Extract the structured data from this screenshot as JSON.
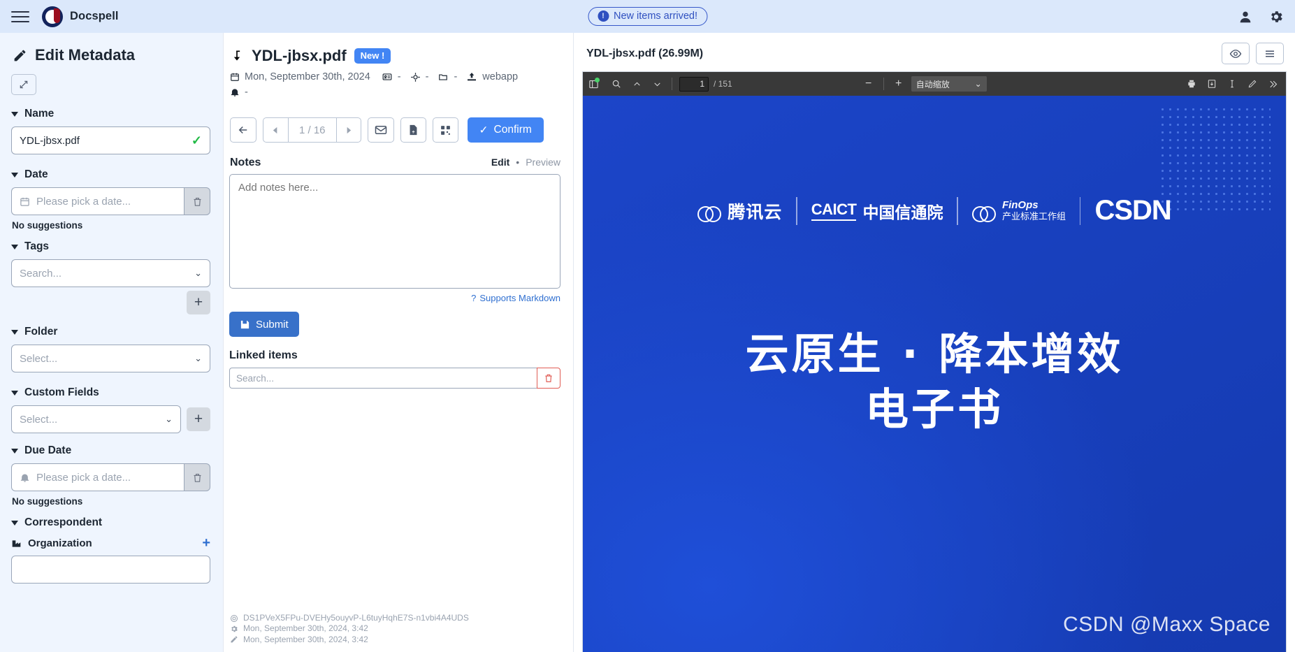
{
  "topbar": {
    "brand": "Docspell",
    "menu_icon": "hamburger-icon",
    "notification": "New items arrived!",
    "user_icon": "user-icon",
    "settings_icon": "gear-icon"
  },
  "sidebar": {
    "title": "Edit Metadata",
    "title_icon": "pencil-icon",
    "expand_icon": "expand-icon",
    "sections": {
      "name": {
        "label": "Name",
        "value": "YDL-jbsx.pdf",
        "status_icon": "check-icon"
      },
      "date": {
        "label": "Date",
        "placeholder": "Please pick a date...",
        "icon": "calendar-icon",
        "clear_icon": "trash-icon",
        "suggestions": "No suggestions"
      },
      "tags": {
        "label": "Tags",
        "placeholder": "Search...",
        "add_label": "+"
      },
      "folder": {
        "label": "Folder",
        "placeholder": "Select..."
      },
      "custom_fields": {
        "label": "Custom Fields",
        "placeholder": "Select...",
        "add_label": "+"
      },
      "due_date": {
        "label": "Due Date",
        "placeholder": "Please pick a date...",
        "icon": "bell-icon",
        "clear_icon": "trash-icon",
        "suggestions": "No suggestions"
      },
      "correspondent": {
        "label": "Correspondent",
        "organization_label": "Organization",
        "organization_icon": "factory-icon",
        "add_label": "+"
      }
    }
  },
  "document": {
    "title": "YDL-jbsx.pdf",
    "title_icon": "download-arrow-icon",
    "badge": "New !",
    "date": "Mon, September 30th, 2024",
    "date_icon": "calendar-icon",
    "correspondent": "-",
    "correspondent_icon": "id-card-icon",
    "concerning": "-",
    "concerning_icon": "crosshair-icon",
    "folder": "-",
    "folder_icon": "folder-icon",
    "source": "webapp",
    "source_icon": "upload-icon",
    "due": "-",
    "due_icon": "bell-icon"
  },
  "toolbar": {
    "back_icon": "arrow-left-icon",
    "prev_icon": "triangle-left-icon",
    "page_indicator": "1 / 16",
    "next_icon": "triangle-right-icon",
    "mail_icon": "envelope-icon",
    "attachment_icon": "file-upload-icon",
    "qr_icon": "qr-code-icon",
    "confirm_label": "Confirm",
    "confirm_icon": "check-icon",
    "confirm_color": "#4285f4",
    "add_icon": "plus-icon",
    "reprocess_icon": "refresh-icon",
    "delete_icon": "trash-icon",
    "delete_color": "#e05c54"
  },
  "notes": {
    "label": "Notes",
    "tab_edit": "Edit",
    "tab_dot": "•",
    "tab_preview": "Preview",
    "placeholder": "Add notes here...",
    "markdown_hint": "Supports Markdown",
    "markdown_hint_icon": "question-icon",
    "submit_label": "Submit",
    "submit_icon": "save-icon"
  },
  "linked_items": {
    "label": "Linked items",
    "placeholder": "Search...",
    "delete_icon": "trash-icon"
  },
  "footer_meta": {
    "id": "DS1PVeX5FPu-DVEHy5ouyvP-L6tuyHqhE7S-n1vbi4A4UDS",
    "id_icon": "target-icon",
    "created": "Mon, September 30th, 2024, 3:42",
    "created_icon": "gear-icon",
    "updated": "Mon, September 30th, 2024, 3:42",
    "updated_icon": "pencil-icon"
  },
  "pdf": {
    "header_title": "YDL-jbsx.pdf (26.99M)",
    "preview_icon": "eye-icon",
    "menu_icon": "list-icon",
    "toolbar": {
      "sidebar_icon": "sidebar-toggle-icon",
      "search_icon": "search-icon",
      "page_up_icon": "chevron-up-icon",
      "page_down_icon": "chevron-down-icon",
      "current_page": "1",
      "total_pages": "/ 151",
      "zoom_out_icon": "minus-icon",
      "zoom_in_icon": "plus-icon",
      "zoom_value": "自动缩放",
      "zoom_caret_icon": "chevron-down-icon",
      "print_icon": "print-icon",
      "download_icon": "download-icon",
      "text_select_icon": "text-cursor-icon",
      "draw_icon": "pencil-icon",
      "more_icon": "double-chevron-right-icon"
    },
    "page_content": {
      "logos": [
        {
          "name": "腾讯云",
          "icon": "tencent-cloud-icon"
        },
        {
          "name": "CAICT",
          "subtitle": "中国信通院"
        },
        {
          "name": "FinOps",
          "subtitle": "产业标准工作组",
          "icon": "finops-icon"
        },
        {
          "name": "CSDN"
        }
      ],
      "headline_line1": "云原生 · 降本增效",
      "headline_line2": "电子书",
      "watermark": "CSDN @Maxx Space",
      "background_color": "#1840bd"
    }
  }
}
